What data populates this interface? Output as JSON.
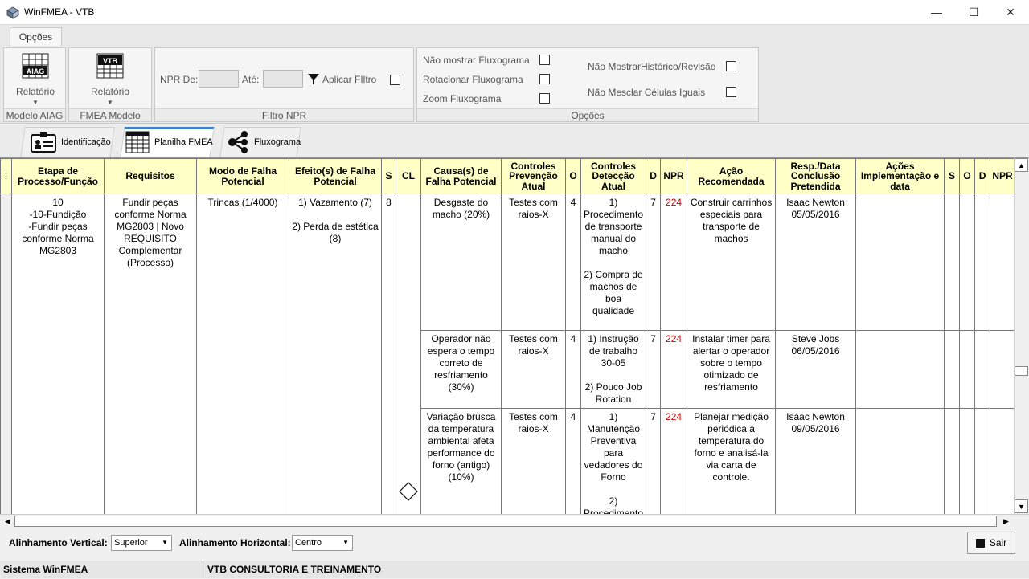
{
  "window": {
    "title": "WinFMEA - VTB",
    "minimize": "—",
    "maximize": "☐",
    "close": "✕"
  },
  "ribbon": {
    "tab": "Opções",
    "aiag": {
      "icon_text": "AIAG",
      "label": "Relatório",
      "group": "Modelo AIAG"
    },
    "vtb": {
      "icon_text": "VTB",
      "label": "Relatório",
      "group": "FMEA Modelo VTB"
    },
    "npr_filter": {
      "from_label": "NPR De:",
      "to_label": "Até:",
      "apply_label": "Aplicar FIltro",
      "group": "Filtro NPR"
    },
    "options": {
      "group": "Opções",
      "items": [
        "Não mostrar Fluxograma",
        "Rotacionar Fluxograma",
        "Zoom Fluxograma",
        "Não MostrarHistórico/Revisão",
        "Não Mesclar Células Iguais"
      ]
    }
  },
  "page_tabs": [
    "Identificação",
    "Planilha FMEA",
    "Fluxograma"
  ],
  "grid": {
    "headers": [
      "Etapa de Processo/Função",
      "Requisitos",
      "Modo de Falha Potencial",
      "Efeito(s) de Falha Potencial",
      "S",
      "CL",
      "Causa(s) de Falha Potencial",
      "Controles Prevenção Atual",
      "O",
      "Controles Detecção Atual",
      "D",
      "NPR",
      "Ação Recomendada",
      "Resp./Data Conclusão Pretendida",
      "Ações Implementação e data",
      "S",
      "O",
      "D",
      "NPR"
    ],
    "process": {
      "etapa": "10\n-10-Fundição\n-Fundir peças conforme Norma MG2803",
      "requisitos": "Fundir peças conforme Norma MG2803 | Novo REQUISITO Complementar (Processo)",
      "modo": "Trincas (1/4000)",
      "efeito": "1) Vazamento (7)\n\n2) Perda de estética (8)",
      "s": "8"
    },
    "rows": [
      {
        "causa": "Desgaste do macho (20%)",
        "prevencao": "Testes com raios-X",
        "o": "4",
        "deteccao": "1) Procedimento de transporte manual do macho\n\n2) Compra de machos de boa qualidade",
        "d": "7",
        "npr": "224",
        "acao": "Construir carrinhos especiais para transporte de machos",
        "resp": "Isaac Newton 05/05/2016"
      },
      {
        "causa": "Operador não espera o tempo correto de resfriamento (30%)",
        "prevencao": "Testes com raios-X",
        "o": "4",
        "deteccao": "1) Instrução de trabalho 30-05\n\n2) Pouco Job Rotation",
        "d": "7",
        "npr": "224",
        "acao": "Instalar timer para alertar o operador sobre o tempo otimizado de resfriamento",
        "resp": "Steve Jobs 06/05/2016"
      },
      {
        "causa": "Variação brusca da temperatura ambiental afeta performance do forno (antigo) (10%)",
        "prevencao": "Testes com raios-X",
        "o": "4",
        "deteccao": "1) Manutenção Preventiva para vedadores do Forno\n\n2) Procedimento",
        "d": "7",
        "npr": "224",
        "acao": "Planejar medição periódica a temperatura do forno e analisá-la via carta de controle.",
        "resp": "Isaac Newton 09/05/2016"
      }
    ]
  },
  "bottom": {
    "vertical_label": "Alinhamento Vertical:",
    "vertical_value": "Superior",
    "horizontal_label": "Alinhamento Horizontal:",
    "horizontal_value": "Centro",
    "exit_label": "Sair"
  },
  "status": {
    "left": "Sistema WinFMEA",
    "right": "VTB CONSULTORIA E TREINAMENTO"
  }
}
